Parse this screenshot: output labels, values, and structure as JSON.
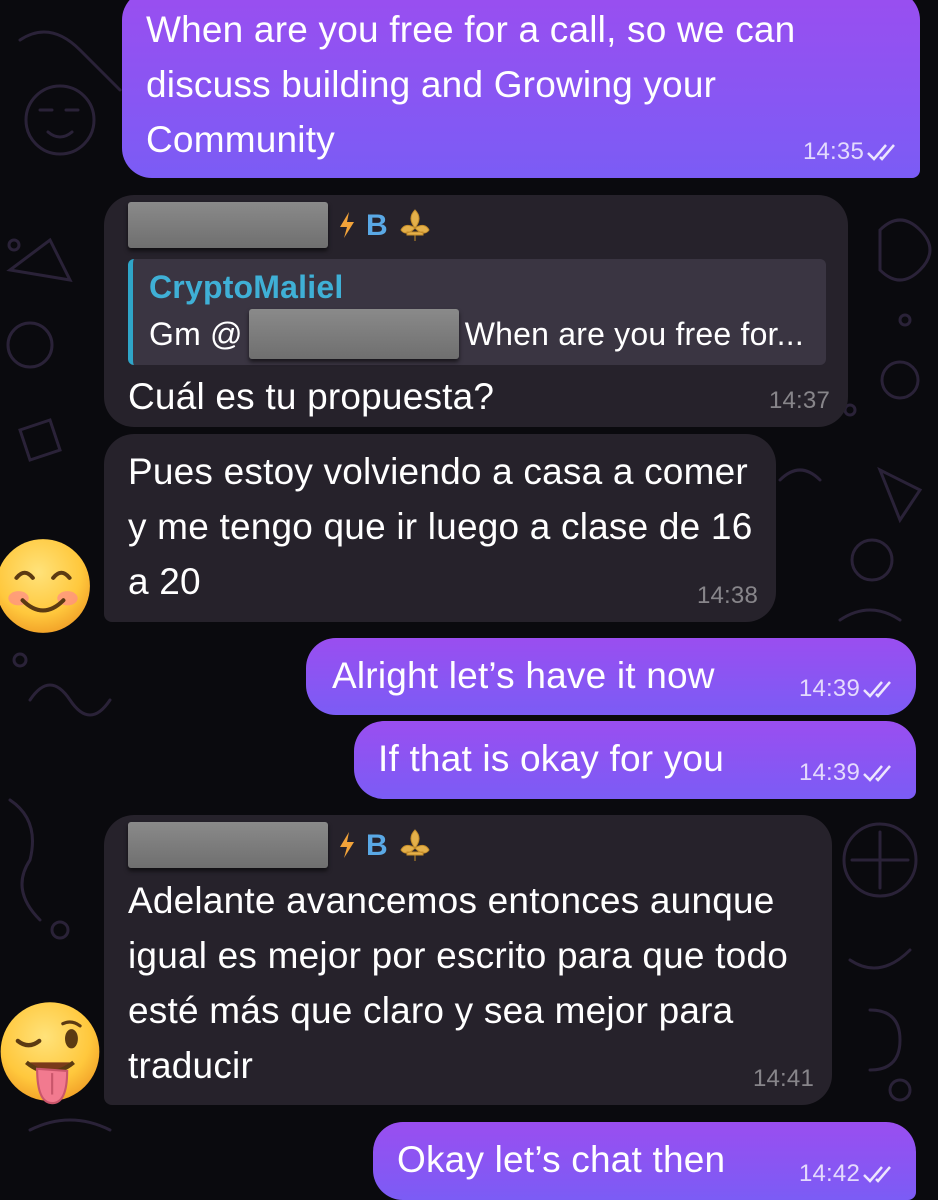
{
  "messages": [
    {
      "direction": "outgoing",
      "text": "When are you free for a call, so we can discuss building and Growing your Community",
      "time": "14:35",
      "status": "double-check-icon"
    },
    {
      "direction": "incoming",
      "sender_badges": [
        "B"
      ],
      "reply": {
        "name": "CryptoMaliel",
        "prefix": "Gm @",
        "suffix": "When are you free for..."
      },
      "text": "Cuál es tu propuesta?",
      "time": "14:37"
    },
    {
      "direction": "incoming",
      "text": "Pues estoy volviendo a casa a comer y me tengo que ir luego a clase de 16 a 20",
      "time": "14:38",
      "avatar": "smiling-face-emoji"
    },
    {
      "direction": "outgoing",
      "text": "Alright let’s have it now",
      "time": "14:39",
      "status": "double-check-icon"
    },
    {
      "direction": "outgoing",
      "text": "If that is okay for you",
      "time": "14:39",
      "status": "double-check-icon"
    },
    {
      "direction": "incoming",
      "sender_badges": [
        "B"
      ],
      "text": "Adelante avancemos entonces aunque igual es mejor por escrito para que todo esté más que claro y sea mejor para traducir",
      "time": "14:41",
      "avatar": "winking-tongue-emoji"
    },
    {
      "direction": "outgoing",
      "text": "Okay let’s chat then",
      "time": "14:42",
      "status": "double-check-icon"
    }
  ],
  "colors": {
    "outgoing_bubble": "#8f54f2",
    "incoming_bubble": "#26222b",
    "reply_accent": "#2fa5c8",
    "background": "#0a0a0e"
  }
}
